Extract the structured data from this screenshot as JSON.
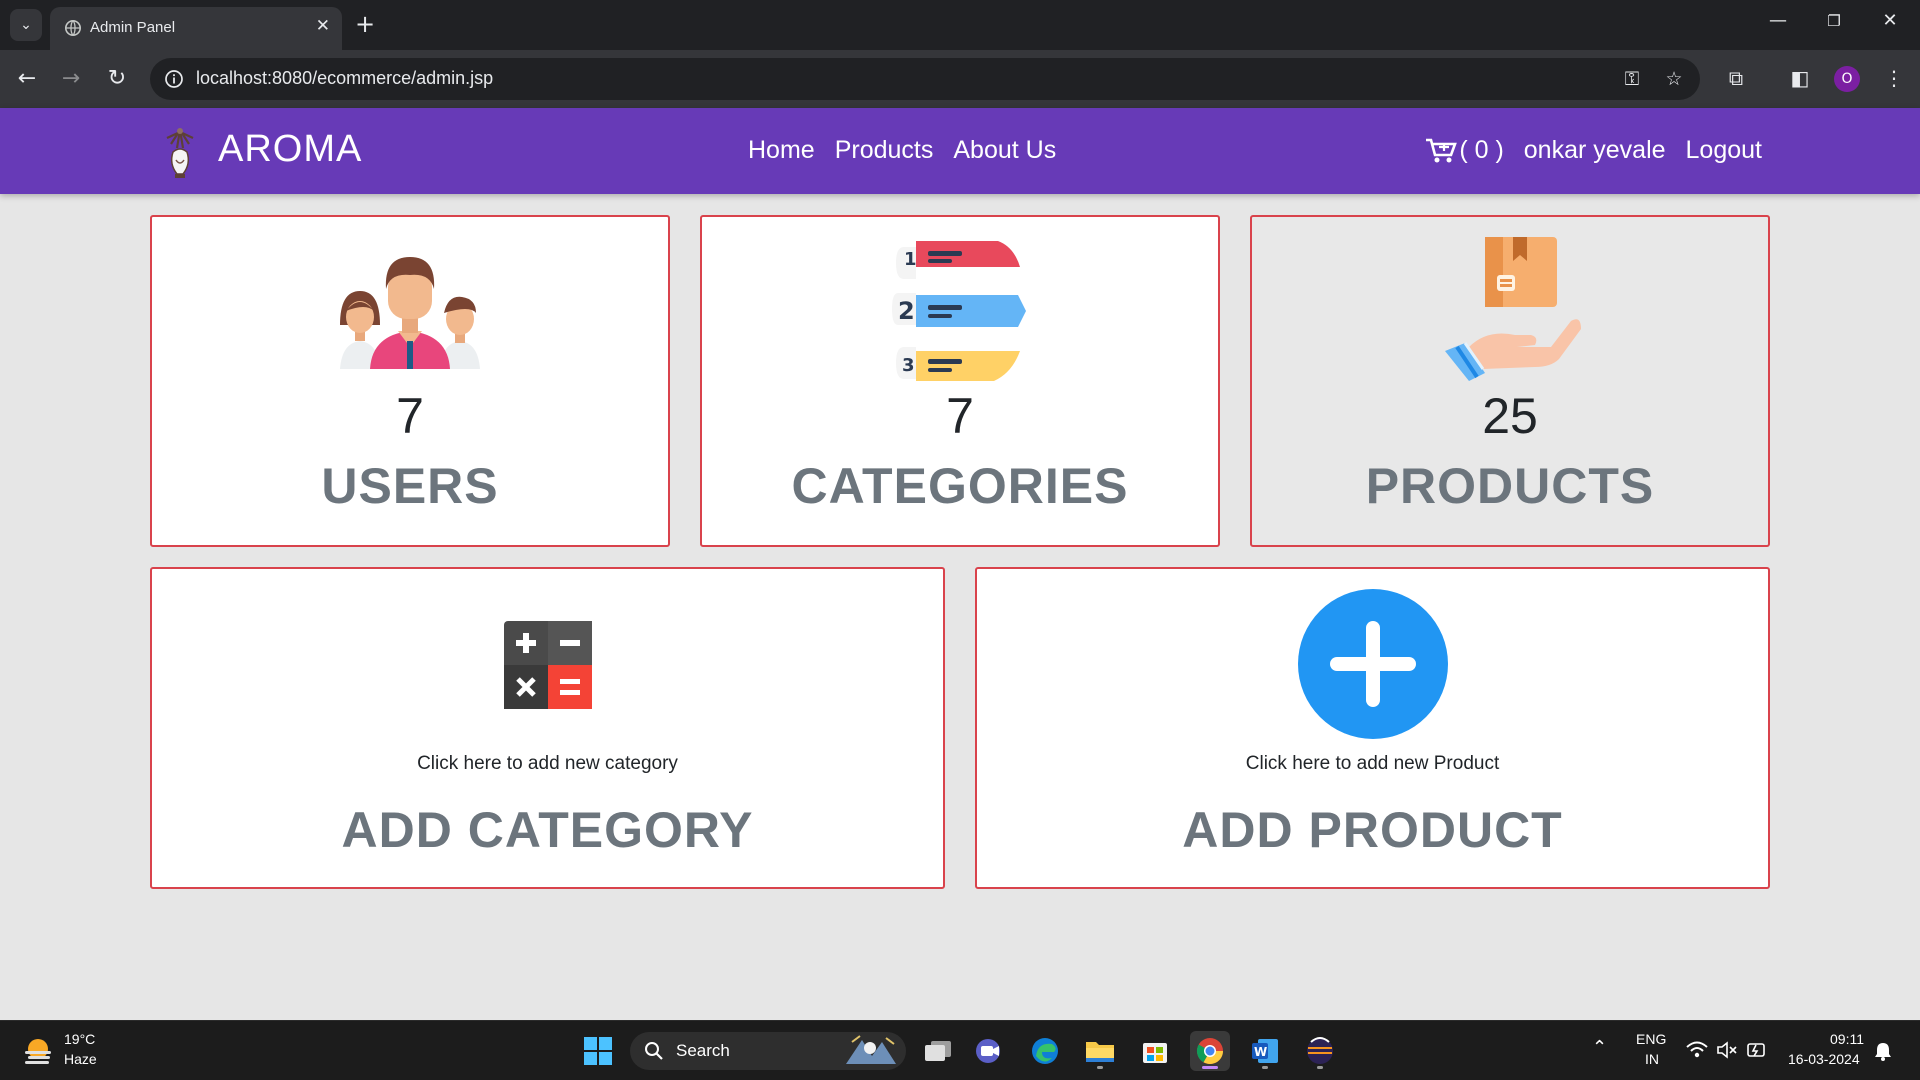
{
  "browser": {
    "tab_title": "Admin Panel",
    "url": "localhost:8080/ecommerce/admin.jsp",
    "profile_initial": "O"
  },
  "site": {
    "brand": "AROMA",
    "nav_links": [
      "Home",
      "Products",
      "About Us"
    ],
    "cart_label": "( 0 )",
    "user_name": "onkar yevale",
    "logout_label": "Logout"
  },
  "stats": [
    {
      "count": "7",
      "label": "USERS",
      "icon": "users-group-icon"
    },
    {
      "count": "7",
      "label": "CATEGORIES",
      "icon": "numbered-list-icon"
    },
    {
      "count": "25",
      "label": "PRODUCTS",
      "icon": "product-box-hand-icon"
    }
  ],
  "actions": [
    {
      "hint": "Click here to add new category",
      "title": "ADD CATEGORY",
      "icon": "calculator-icon"
    },
    {
      "hint": "Click here to add new Product",
      "title": "ADD PRODUCT",
      "icon": "plus-circle-icon"
    }
  ],
  "taskbar": {
    "temperature": "19°C",
    "condition": "Haze",
    "search_label": "Search",
    "lang_top": "ENG",
    "lang_bottom": "IN",
    "time": "09:11",
    "date": "16-03-2024"
  },
  "colors": {
    "navbar": "#673ab7",
    "card_border": "#d9434c",
    "label_gray": "#6c757d",
    "add_product_blue": "#2196f3"
  }
}
